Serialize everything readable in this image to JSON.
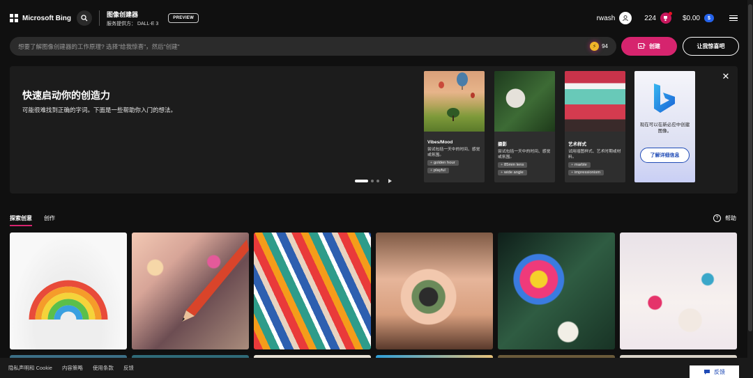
{
  "header": {
    "brand": "Microsoft Bing",
    "title": "图像创建器",
    "subtitle": "服务提供方： DALL-E 3",
    "preview_badge": "PREVIEW",
    "username": "rwash",
    "coins": "224",
    "balance": "$0.00",
    "balance_icon": "$"
  },
  "prompt": {
    "placeholder": "想要了解图像创建器的工作原理? 选择\"给我惊喜\"，然后\"创建\"",
    "boosts": "94",
    "create_label": "创建",
    "surprise_label": "让我惊喜吧"
  },
  "hero": {
    "title": "快速启动你的创造力",
    "description": "可能很难找到正确的字词。下面是一些帮助你入门的想法。",
    "cards": [
      {
        "title": "Vibes/Mood",
        "desc": "尝试包括一天中的时间、感觉或氛围。",
        "tags": [
          "golden hour",
          "playful"
        ]
      },
      {
        "title": "摄影",
        "desc": "尝试包括一天中的时间、感觉或氛围。",
        "tags": [
          "85mm lens",
          "wide angle"
        ]
      },
      {
        "title": "艺术样式",
        "desc": "试用插图样式、艺术时期或材料。",
        "tags": [
          "marble",
          "impressionism"
        ]
      }
    ],
    "promo_text": "现在可以在新必应中创建图像。",
    "promo_button": "了解详细信息"
  },
  "tabs": [
    "探索创意",
    "创作"
  ],
  "help_label": "帮助",
  "footer": {
    "links": [
      "隐私声明和 Cookie",
      "内容策略",
      "使用条款",
      "反馈"
    ],
    "feedback_button": "反馈"
  },
  "colors": {
    "accent": "#d6246e",
    "background": "#101010",
    "link_blue": "#1f4bb6"
  }
}
